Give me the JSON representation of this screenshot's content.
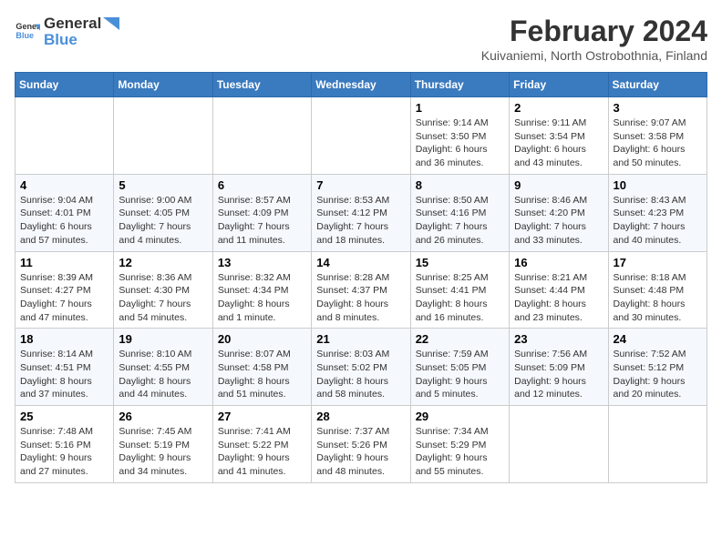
{
  "header": {
    "logo_line1": "General",
    "logo_line2": "Blue",
    "month": "February 2024",
    "location": "Kuivaniemi, North Ostrobothnia, Finland"
  },
  "weekdays": [
    "Sunday",
    "Monday",
    "Tuesday",
    "Wednesday",
    "Thursday",
    "Friday",
    "Saturday"
  ],
  "weeks": [
    [
      {
        "date": "",
        "info": ""
      },
      {
        "date": "",
        "info": ""
      },
      {
        "date": "",
        "info": ""
      },
      {
        "date": "",
        "info": ""
      },
      {
        "date": "1",
        "info": "Sunrise: 9:14 AM\nSunset: 3:50 PM\nDaylight: 6 hours\nand 36 minutes."
      },
      {
        "date": "2",
        "info": "Sunrise: 9:11 AM\nSunset: 3:54 PM\nDaylight: 6 hours\nand 43 minutes."
      },
      {
        "date": "3",
        "info": "Sunrise: 9:07 AM\nSunset: 3:58 PM\nDaylight: 6 hours\nand 50 minutes."
      }
    ],
    [
      {
        "date": "4",
        "info": "Sunrise: 9:04 AM\nSunset: 4:01 PM\nDaylight: 6 hours\nand 57 minutes."
      },
      {
        "date": "5",
        "info": "Sunrise: 9:00 AM\nSunset: 4:05 PM\nDaylight: 7 hours\nand 4 minutes."
      },
      {
        "date": "6",
        "info": "Sunrise: 8:57 AM\nSunset: 4:09 PM\nDaylight: 7 hours\nand 11 minutes."
      },
      {
        "date": "7",
        "info": "Sunrise: 8:53 AM\nSunset: 4:12 PM\nDaylight: 7 hours\nand 18 minutes."
      },
      {
        "date": "8",
        "info": "Sunrise: 8:50 AM\nSunset: 4:16 PM\nDaylight: 7 hours\nand 26 minutes."
      },
      {
        "date": "9",
        "info": "Sunrise: 8:46 AM\nSunset: 4:20 PM\nDaylight: 7 hours\nand 33 minutes."
      },
      {
        "date": "10",
        "info": "Sunrise: 8:43 AM\nSunset: 4:23 PM\nDaylight: 7 hours\nand 40 minutes."
      }
    ],
    [
      {
        "date": "11",
        "info": "Sunrise: 8:39 AM\nSunset: 4:27 PM\nDaylight: 7 hours\nand 47 minutes."
      },
      {
        "date": "12",
        "info": "Sunrise: 8:36 AM\nSunset: 4:30 PM\nDaylight: 7 hours\nand 54 minutes."
      },
      {
        "date": "13",
        "info": "Sunrise: 8:32 AM\nSunset: 4:34 PM\nDaylight: 8 hours\nand 1 minute."
      },
      {
        "date": "14",
        "info": "Sunrise: 8:28 AM\nSunset: 4:37 PM\nDaylight: 8 hours\nand 8 minutes."
      },
      {
        "date": "15",
        "info": "Sunrise: 8:25 AM\nSunset: 4:41 PM\nDaylight: 8 hours\nand 16 minutes."
      },
      {
        "date": "16",
        "info": "Sunrise: 8:21 AM\nSunset: 4:44 PM\nDaylight: 8 hours\nand 23 minutes."
      },
      {
        "date": "17",
        "info": "Sunrise: 8:18 AM\nSunset: 4:48 PM\nDaylight: 8 hours\nand 30 minutes."
      }
    ],
    [
      {
        "date": "18",
        "info": "Sunrise: 8:14 AM\nSunset: 4:51 PM\nDaylight: 8 hours\nand 37 minutes."
      },
      {
        "date": "19",
        "info": "Sunrise: 8:10 AM\nSunset: 4:55 PM\nDaylight: 8 hours\nand 44 minutes."
      },
      {
        "date": "20",
        "info": "Sunrise: 8:07 AM\nSunset: 4:58 PM\nDaylight: 8 hours\nand 51 minutes."
      },
      {
        "date": "21",
        "info": "Sunrise: 8:03 AM\nSunset: 5:02 PM\nDaylight: 8 hours\nand 58 minutes."
      },
      {
        "date": "22",
        "info": "Sunrise: 7:59 AM\nSunset: 5:05 PM\nDaylight: 9 hours\nand 5 minutes."
      },
      {
        "date": "23",
        "info": "Sunrise: 7:56 AM\nSunset: 5:09 PM\nDaylight: 9 hours\nand 12 minutes."
      },
      {
        "date": "24",
        "info": "Sunrise: 7:52 AM\nSunset: 5:12 PM\nDaylight: 9 hours\nand 20 minutes."
      }
    ],
    [
      {
        "date": "25",
        "info": "Sunrise: 7:48 AM\nSunset: 5:16 PM\nDaylight: 9 hours\nand 27 minutes."
      },
      {
        "date": "26",
        "info": "Sunrise: 7:45 AM\nSunset: 5:19 PM\nDaylight: 9 hours\nand 34 minutes."
      },
      {
        "date": "27",
        "info": "Sunrise: 7:41 AM\nSunset: 5:22 PM\nDaylight: 9 hours\nand 41 minutes."
      },
      {
        "date": "28",
        "info": "Sunrise: 7:37 AM\nSunset: 5:26 PM\nDaylight: 9 hours\nand 48 minutes."
      },
      {
        "date": "29",
        "info": "Sunrise: 7:34 AM\nSunset: 5:29 PM\nDaylight: 9 hours\nand 55 minutes."
      },
      {
        "date": "",
        "info": ""
      },
      {
        "date": "",
        "info": ""
      }
    ]
  ]
}
